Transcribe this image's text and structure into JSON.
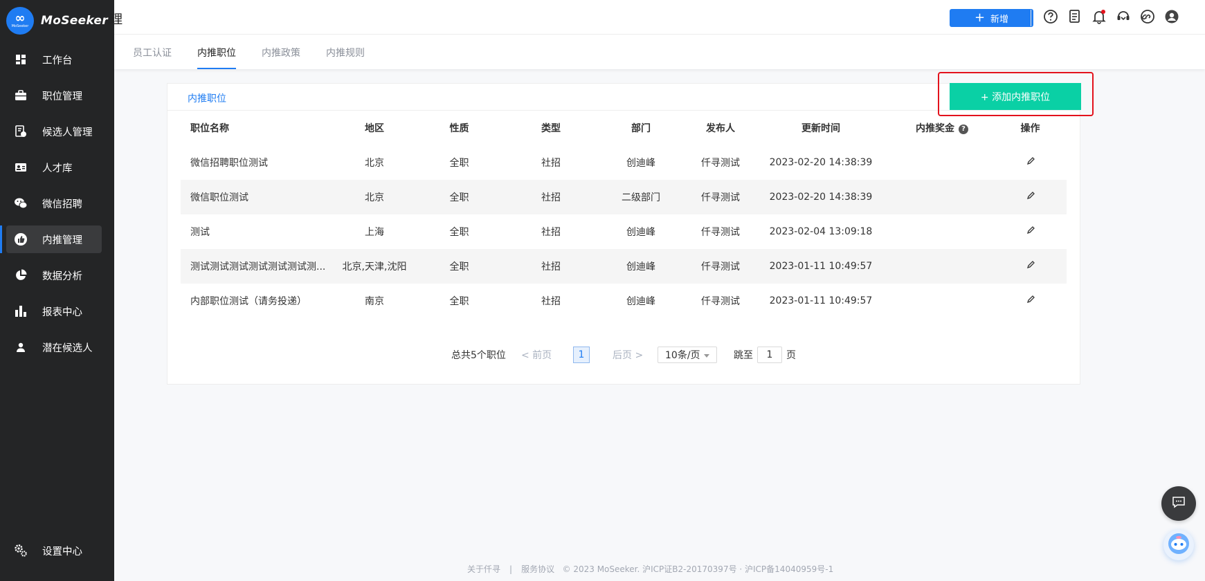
{
  "brand": {
    "name": "MoSeeker",
    "logo_small": "MoSeeker",
    "accent": "#1f7cf2"
  },
  "header": {
    "title_fragment": "理",
    "new_button": "新增"
  },
  "sidebar": {
    "items": [
      {
        "label": "工作台",
        "icon": "dashboard-icon"
      },
      {
        "label": "职位管理",
        "icon": "briefcase-icon"
      },
      {
        "label": "候选人管理",
        "icon": "candidate-icon"
      },
      {
        "label": "人才库",
        "icon": "id-card-icon"
      },
      {
        "label": "微信招聘",
        "icon": "wechat-icon"
      },
      {
        "label": "内推管理",
        "icon": "thumbs-up-icon",
        "active": true
      },
      {
        "label": "数据分析",
        "icon": "pie-chart-icon"
      },
      {
        "label": "报表中心",
        "icon": "bar-chart-icon"
      },
      {
        "label": "潜在候选人",
        "icon": "person-icon"
      }
    ],
    "settings_label": "设置中心"
  },
  "tabs": [
    "员工认证",
    "内推职位",
    "内推政策",
    "内推规则"
  ],
  "active_tab": "内推职位",
  "card": {
    "title": "内推职位",
    "add_button": "+ 添加内推职位"
  },
  "table": {
    "columns": [
      "职位名称",
      "地区",
      "性质",
      "类型",
      "部门",
      "发布人",
      "更新时间",
      "内推奖金",
      "操作"
    ],
    "bonus_help": "?",
    "rows": [
      {
        "name": "微信招聘职位测试",
        "region": "北京",
        "nature": "全职",
        "type": "社招",
        "dept": "创迪峰",
        "publisher": "仟寻测试",
        "updated": "2023-02-20 14:38:39",
        "bonus": ""
      },
      {
        "name": "微信职位测试",
        "region": "北京",
        "nature": "全职",
        "type": "社招",
        "dept": "二级部门",
        "publisher": "仟寻测试",
        "updated": "2023-02-20 14:38:39",
        "bonus": ""
      },
      {
        "name": "测试",
        "region": "上海",
        "nature": "全职",
        "type": "社招",
        "dept": "创迪峰",
        "publisher": "仟寻测试",
        "updated": "2023-02-04 13:09:18",
        "bonus": ""
      },
      {
        "name": "测试测试测试测试测试测试测...",
        "region": "北京,天津,沈阳",
        "nature": "全职",
        "type": "社招",
        "dept": "创迪峰",
        "publisher": "仟寻测试",
        "updated": "2023-01-11 10:49:57",
        "bonus": ""
      },
      {
        "name": "内部职位测试（请务投递）",
        "region": "南京",
        "nature": "全职",
        "type": "社招",
        "dept": "创迪峰",
        "publisher": "仟寻测试",
        "updated": "2023-01-11 10:49:57",
        "bonus": ""
      }
    ]
  },
  "pagination": {
    "total": "总共5个职位",
    "prev": "< 前页",
    "current": "1",
    "next": "后页 >",
    "page_size": "10条/页",
    "jump_label": "跳至",
    "jump_value": "1",
    "page_unit": "页"
  },
  "footer": {
    "about": "关于仟寻",
    "separator": "|",
    "terms": "服务协议",
    "copyright": "© 2023 MoSeeker. 沪ICP证B2-20170397号 · 沪ICP备14040959号-1"
  },
  "colors": {
    "add_button": "#0ad0a5",
    "highlight": "#e3121c",
    "sidebar_bg": "#242526"
  }
}
